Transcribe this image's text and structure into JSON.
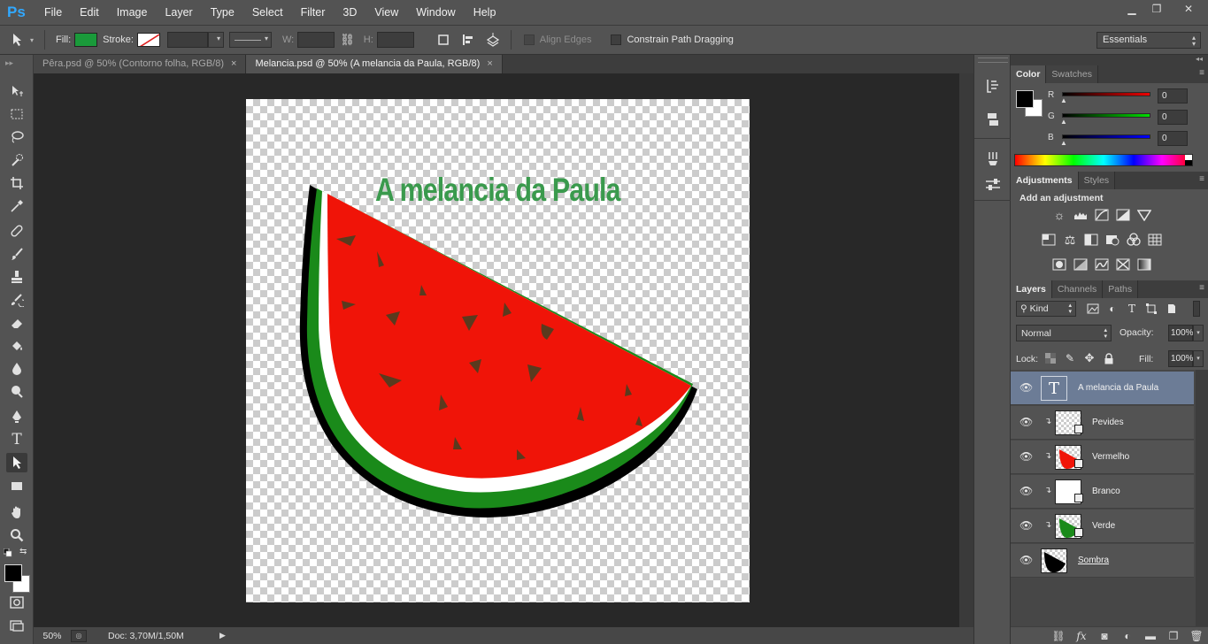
{
  "app": {
    "logo": "Ps"
  },
  "menu": [
    "File",
    "Edit",
    "Image",
    "Layer",
    "Type",
    "Select",
    "Filter",
    "3D",
    "View",
    "Window",
    "Help"
  ],
  "window_controls": {
    "minimize": "▁",
    "restore": "❐",
    "close": "✕"
  },
  "options": {
    "fill_label": "Fill:",
    "fill_color": "#1a9a3a",
    "stroke_label": "Stroke:",
    "w_label": "W:",
    "h_label": "H:",
    "link_icon": "⛓",
    "align_edges": "Align Edges",
    "constrain": "Constrain Path Dragging",
    "workspace": "Essentials"
  },
  "tabs": [
    {
      "label": "Pêra.psd @ 50% (Contorno folha, RGB/8)",
      "close": "×"
    },
    {
      "label": "Melancia.psd @ 50% (A melancia da Paula, RGB/8)",
      "close": "×"
    }
  ],
  "document": {
    "title_text": "A melancia da Paula"
  },
  "status": {
    "zoom": "50%",
    "doc": "Doc: 3,70M/1,50M",
    "arrow": "▶"
  },
  "color_panel": {
    "tabs": [
      "Color",
      "Swatches"
    ],
    "r_label": "R",
    "g_label": "G",
    "b_label": "B",
    "r": "0",
    "g": "0",
    "b": "0"
  },
  "adjustments_panel": {
    "tabs": [
      "Adjustments",
      "Styles"
    ],
    "heading": "Add an adjustment"
  },
  "layers_panel": {
    "tabs": [
      "Layers",
      "Channels",
      "Paths"
    ],
    "kind": "Kind",
    "blend_mode": "Normal",
    "opacity_label": "Opacity:",
    "opacity": "100%",
    "lock_label": "Lock:",
    "fill_label": "Fill:",
    "fill": "100%",
    "text_thumb": "T",
    "layers": [
      {
        "name": "A melancia da Paula",
        "type": "text",
        "selected": true
      },
      {
        "name": "Pevides",
        "type": "pixel",
        "clipped": true
      },
      {
        "name": "Vermelho",
        "type": "pixel",
        "clipped": true
      },
      {
        "name": "Branco",
        "type": "pixel",
        "clipped": true
      },
      {
        "name": "Verde",
        "type": "pixel",
        "clipped": true
      },
      {
        "name": "Sombra",
        "type": "pixel",
        "clipped": false
      }
    ]
  },
  "colors": {
    "watermelon_red": "#f01408",
    "rind_green": "#1a8a1a",
    "rind_white": "#ffffff",
    "shadow": "#000000",
    "seed": "#5a3a1e",
    "title_green": "#3a9a4d"
  }
}
